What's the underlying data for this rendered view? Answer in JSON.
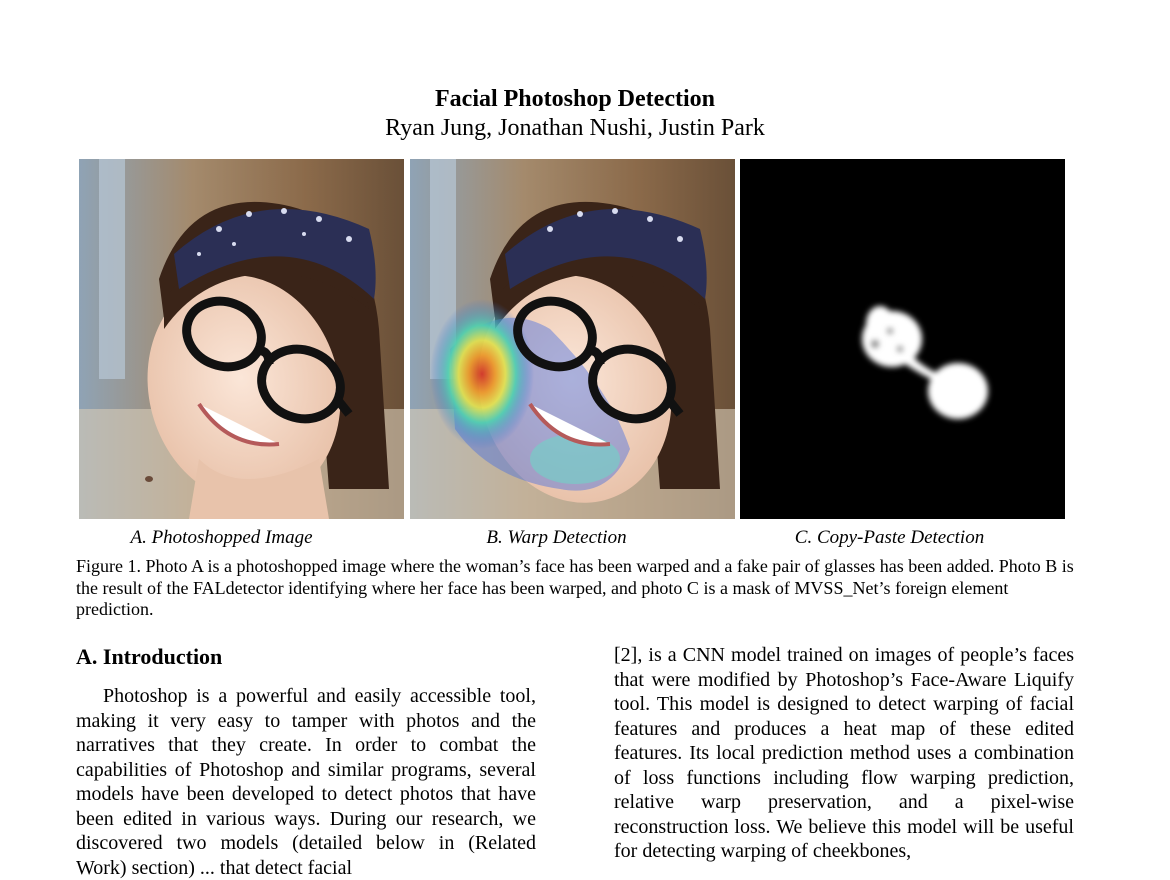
{
  "paper": {
    "title": "Facial Photoshop Detection",
    "authors": "Ryan Jung, Jonathan Nushi, Justin Park"
  },
  "figure": {
    "panels": [
      {
        "label": "A. Photoshopped Image"
      },
      {
        "label": "B. Warp Detection"
      },
      {
        "label": "C. Copy-Paste Detection"
      }
    ],
    "caption": "Figure 1. Photo A is a photoshopped image where the woman’s face has been warped and a fake pair of glasses has been added. Photo B is the result of the FALdetector identifying where her face has been warped, and photo C is a mask of MVSS_Net’s foreign element prediction."
  },
  "section": {
    "heading": "A. Introduction",
    "left_text": "Photoshop is a powerful and easily accessible tool, making it very easy to tamper with photos and the narratives that they create. In order to combat the capabilities of Photoshop and similar programs, several models have been developed to detect photos that have been edited in various ways. During our research, we discovered two models (detailed below in (Related Work) section) ... that detect facial",
    "right_text": "[2], is a CNN model trained on images of people’s faces that were modified by Photoshop’s Face-Aware Liquify tool. This model is designed to detect warping of facial features and produces a heat map of these edited features. Its local prediction method uses a combination of loss functions including flow warping prediction, relative warp preservation, and a pixel-wise reconstruction loss. We believe this model will be useful for detecting warping of cheekbones,"
  },
  "colors": {
    "background": "#ffffff",
    "text": "#000000",
    "mask_background": "#000000",
    "mask_foreground": "#ffffff"
  }
}
